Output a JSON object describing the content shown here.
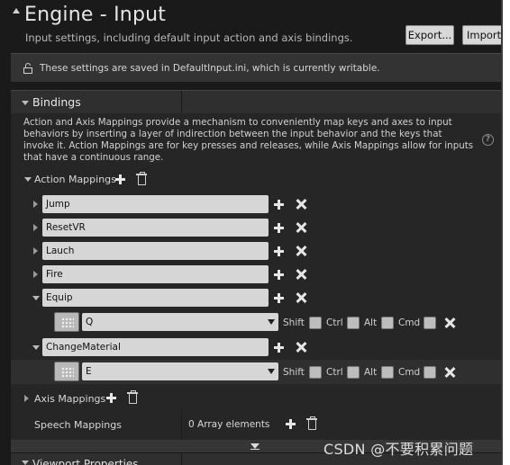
{
  "header": {
    "title": "Engine - Input",
    "subtitle": "Input settings, including default input action and axis bindings.",
    "export_label": "Export...",
    "import_label": "Import"
  },
  "notice": {
    "text": "These settings are saved in DefaultInput.ini, which is currently writable.",
    "icon": "unlock-icon"
  },
  "bindings": {
    "label": "Bindings",
    "description": "Action and Axis Mappings provide a mechanism to conveniently map keys and axes to input behaviors by inserting a layer of indirection between the input behavior and the keys that invoke it. Action Mappings are for key presses and releases, while Axis Mappings allow for inputs that have a continuous range.",
    "action_mappings_label": "Action Mappings",
    "axis_mappings_label": "Axis Mappings",
    "speech_mappings_label": "Speech Mappings",
    "speech_mappings_value": "0 Array elements",
    "actions": [
      {
        "name": "Jump"
      },
      {
        "name": "ResetVR"
      },
      {
        "name": "Lauch"
      },
      {
        "name": "Fire"
      },
      {
        "name": "Equip",
        "key": "Q"
      },
      {
        "name": "ChangeMaterial",
        "key": "E"
      }
    ],
    "modifiers": {
      "shift": "Shift",
      "ctrl": "Ctrl",
      "alt": "Alt",
      "cmd": "Cmd"
    }
  },
  "viewport": {
    "label": "Viewport Properties"
  },
  "watermark": "CSDN @不要积累问题"
}
